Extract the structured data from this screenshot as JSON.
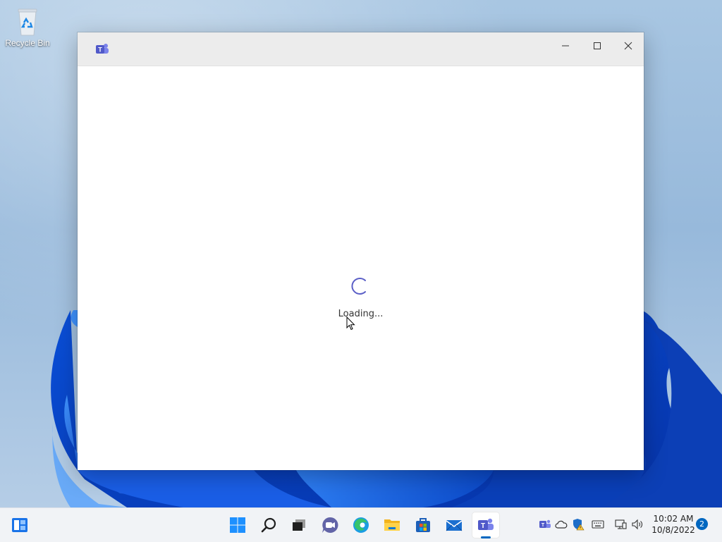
{
  "desktop": {
    "icons": [
      {
        "label": "Recycle Bin",
        "icon": "recycle-bin-icon"
      }
    ]
  },
  "window": {
    "app_icon": "teams-icon",
    "controls": {
      "minimize": "minimize-icon",
      "maximize": "maximize-icon",
      "close": "close-icon"
    },
    "content": {
      "status_text": "Loading...",
      "spinner": "spinner-icon"
    }
  },
  "taskbar": {
    "items": [
      {
        "name": "widgets",
        "icon": "widgets-icon"
      },
      {
        "name": "start",
        "icon": "windows-start-icon"
      },
      {
        "name": "search",
        "icon": "search-icon"
      },
      {
        "name": "task-view",
        "icon": "task-view-icon"
      },
      {
        "name": "chat",
        "icon": "chat-icon"
      },
      {
        "name": "edge",
        "icon": "edge-icon"
      },
      {
        "name": "file-explorer",
        "icon": "folder-icon"
      },
      {
        "name": "store",
        "icon": "store-icon"
      },
      {
        "name": "mail",
        "icon": "mail-icon"
      },
      {
        "name": "teams",
        "icon": "teams-icon",
        "active": true
      }
    ],
    "tray": [
      {
        "name": "teams",
        "icon": "teams-icon"
      },
      {
        "name": "onedrive",
        "icon": "cloud-icon"
      },
      {
        "name": "security",
        "icon": "shield-warning-icon"
      },
      {
        "name": "keyboard",
        "icon": "keyboard-icon"
      },
      {
        "name": "network",
        "icon": "network-icon"
      },
      {
        "name": "volume",
        "icon": "speaker-icon"
      }
    ],
    "clock": {
      "time": "10:02 AM",
      "date": "10/8/2022"
    },
    "notifications": {
      "count": "2"
    }
  },
  "colors": {
    "accent": "#0067c0",
    "teams_purple": "#5059c9",
    "taskbar_bg": "#f1f3f6"
  }
}
